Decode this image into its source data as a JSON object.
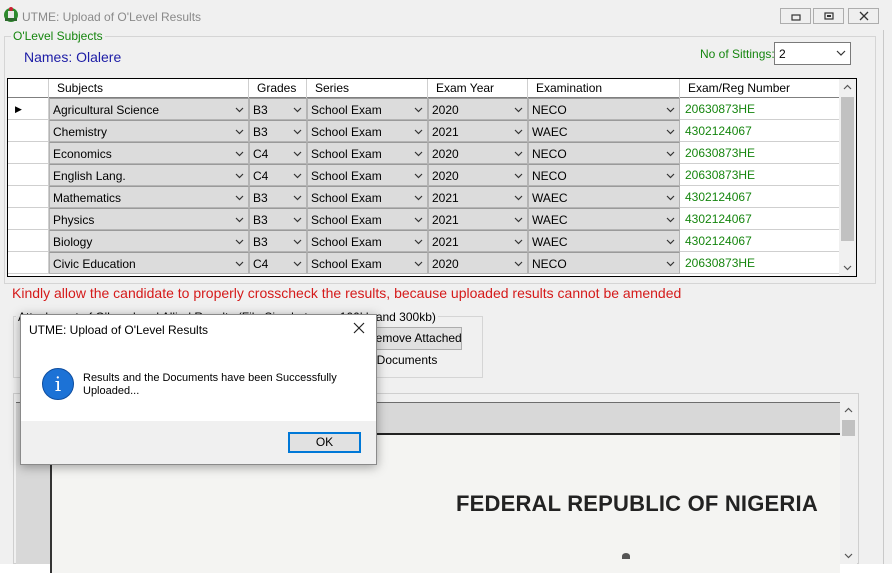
{
  "window": {
    "title": "UTME: Upload of O'Level Results"
  },
  "olevel": {
    "group_label": "O'Level Subjects",
    "names_text": "Names: Olalere",
    "sittings_label": "No of Sittings:",
    "sittings_value": "2"
  },
  "grid": {
    "headers": [
      "Subjects",
      "Grades",
      "Series",
      "Exam Year",
      "Examination",
      "Exam/Reg Number"
    ],
    "rows": [
      {
        "subject": "Agricultural Science",
        "grade": "B3",
        "series": "School Exam",
        "year": "2020",
        "exam": "NECO",
        "reg": "20630873HE",
        "current": true
      },
      {
        "subject": "Chemistry",
        "grade": "B3",
        "series": "School Exam",
        "year": "2021",
        "exam": "WAEC",
        "reg": "4302124067"
      },
      {
        "subject": "Economics",
        "grade": "C4",
        "series": "School Exam",
        "year": "2020",
        "exam": "NECO",
        "reg": "20630873HE"
      },
      {
        "subject": "English Lang.",
        "grade": "C4",
        "series": "School Exam",
        "year": "2020",
        "exam": "NECO",
        "reg": "20630873HE"
      },
      {
        "subject": "Mathematics",
        "grade": "B3",
        "series": "School Exam",
        "year": "2021",
        "exam": "WAEC",
        "reg": "4302124067"
      },
      {
        "subject": "Physics",
        "grade": "B3",
        "series": "School Exam",
        "year": "2021",
        "exam": "WAEC",
        "reg": "4302124067"
      },
      {
        "subject": "Biology",
        "grade": "B3",
        "series": "School Exam",
        "year": "2021",
        "exam": "WAEC",
        "reg": "4302124067"
      },
      {
        "subject": "Civic Education",
        "grade": "C4",
        "series": "School Exam",
        "year": "2020",
        "exam": "NECO",
        "reg": "20630873HE"
      }
    ]
  },
  "warning_text": "Kindly allow the candidate to properly crosscheck the results, because uploaded results cannot be amended",
  "attachments": {
    "group_label": "Attachment of O'Level and Allied Results (File Size between 100kb and 300kb)",
    "remove_button": "Remove Attached File(s)",
    "all_documents": "All Documents"
  },
  "preview": {
    "heading": "FEDERAL REPUBLIC OF NIGERIA"
  },
  "dialog": {
    "title": "UTME: Upload of O'Level Results",
    "message": "Results and the Documents have been Successfully Uploaded...",
    "ok_label": "OK"
  },
  "colors": {
    "green": "#16860f",
    "red": "#d51a1a",
    "blue": "#1c1ca6",
    "accent": "#0078d7"
  }
}
